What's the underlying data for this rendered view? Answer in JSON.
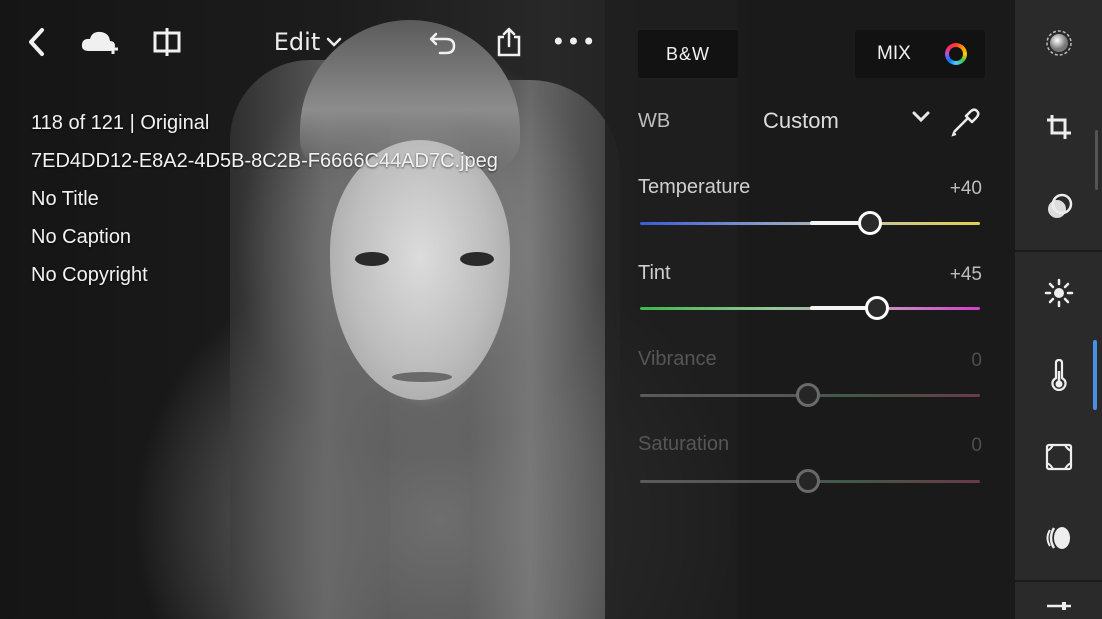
{
  "toolbar": {
    "back_icon": "chevron-left-icon",
    "cloud_icon": "cloud-add-icon",
    "split_icon": "compare-split-icon",
    "mode_label": "Edit",
    "undo_icon": "undo-icon",
    "share_icon": "share-icon",
    "more_label": "•••"
  },
  "info": {
    "position": "118 of 121 | Original",
    "filename": "7ED4DD12-E8A2-4D5B-8C2B-F6666C44AD7C.jpeg",
    "title": "No Title",
    "caption": "No Caption",
    "copyright": "No Copyright"
  },
  "panel": {
    "bw_label": "B&W",
    "mix_label": "MIX",
    "wb_label": "WB",
    "wb_value": "Custom",
    "sliders": [
      {
        "label": "Temperature",
        "value": "+40",
        "position": 0.68,
        "enabled": true
      },
      {
        "label": "Tint",
        "value": "+45",
        "position": 0.7,
        "enabled": true
      },
      {
        "label": "Vibrance",
        "value": "0",
        "position": 0.5,
        "enabled": false
      },
      {
        "label": "Saturation",
        "value": "0",
        "position": 0.5,
        "enabled": false
      }
    ]
  },
  "rail": {
    "items": [
      "presets-icon",
      "crop-icon",
      "healing-icon",
      "light-icon",
      "color-temperature-icon",
      "effects-vignette-icon",
      "detail-lens-icon",
      "adjust-sliders-icon"
    ],
    "active_index": 4
  },
  "colors": {
    "accent": "#4a90e2",
    "panel_bg": "#1e1e1e",
    "rail_bg": "#2a2a2a"
  }
}
